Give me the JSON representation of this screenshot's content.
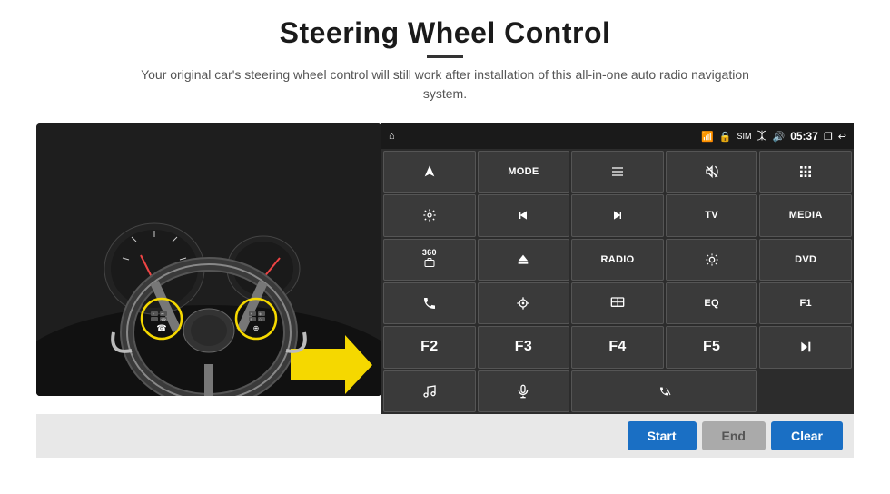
{
  "header": {
    "title": "Steering Wheel Control",
    "subtitle": "Your original car's steering wheel control will still work after installation of this all-in-one auto radio navigation system."
  },
  "statusBar": {
    "time": "05:37",
    "icons": [
      "wifi",
      "lock",
      "sim",
      "bluetooth",
      "volume",
      "window",
      "back"
    ]
  },
  "controlButtons": [
    {
      "id": "btn-navigate",
      "label": "",
      "icon": "navigate"
    },
    {
      "id": "btn-mode",
      "label": "MODE",
      "icon": ""
    },
    {
      "id": "btn-list",
      "label": "",
      "icon": "list"
    },
    {
      "id": "btn-mute",
      "label": "",
      "icon": "mute"
    },
    {
      "id": "btn-apps",
      "label": "",
      "icon": "apps"
    },
    {
      "id": "btn-settings",
      "label": "",
      "icon": "settings"
    },
    {
      "id": "btn-prev",
      "label": "",
      "icon": "prev"
    },
    {
      "id": "btn-next",
      "label": "",
      "icon": "next"
    },
    {
      "id": "btn-tv",
      "label": "TV",
      "icon": ""
    },
    {
      "id": "btn-media",
      "label": "MEDIA",
      "icon": ""
    },
    {
      "id": "btn-360",
      "label": "",
      "icon": "360cam"
    },
    {
      "id": "btn-eject",
      "label": "",
      "icon": "eject"
    },
    {
      "id": "btn-radio",
      "label": "RADIO",
      "icon": ""
    },
    {
      "id": "btn-brightness",
      "label": "",
      "icon": "brightness"
    },
    {
      "id": "btn-dvd",
      "label": "DVD",
      "icon": ""
    },
    {
      "id": "btn-phone",
      "label": "",
      "icon": "phone"
    },
    {
      "id": "btn-nav2",
      "label": "",
      "icon": "gps"
    },
    {
      "id": "btn-window",
      "label": "",
      "icon": "window2"
    },
    {
      "id": "btn-eq",
      "label": "EQ",
      "icon": ""
    },
    {
      "id": "btn-f1",
      "label": "F1",
      "icon": ""
    },
    {
      "id": "btn-f2",
      "label": "F2",
      "icon": ""
    },
    {
      "id": "btn-f3",
      "label": "F3",
      "icon": ""
    },
    {
      "id": "btn-f4",
      "label": "F4",
      "icon": ""
    },
    {
      "id": "btn-f5",
      "label": "F5",
      "icon": ""
    },
    {
      "id": "btn-playpause",
      "label": "",
      "icon": "playpause"
    },
    {
      "id": "btn-music",
      "label": "",
      "icon": "music"
    },
    {
      "id": "btn-mic",
      "label": "",
      "icon": "mic"
    },
    {
      "id": "btn-call",
      "label": "",
      "icon": "call"
    }
  ],
  "bottomBar": {
    "startLabel": "Start",
    "endLabel": "End",
    "clearLabel": "Clear"
  }
}
